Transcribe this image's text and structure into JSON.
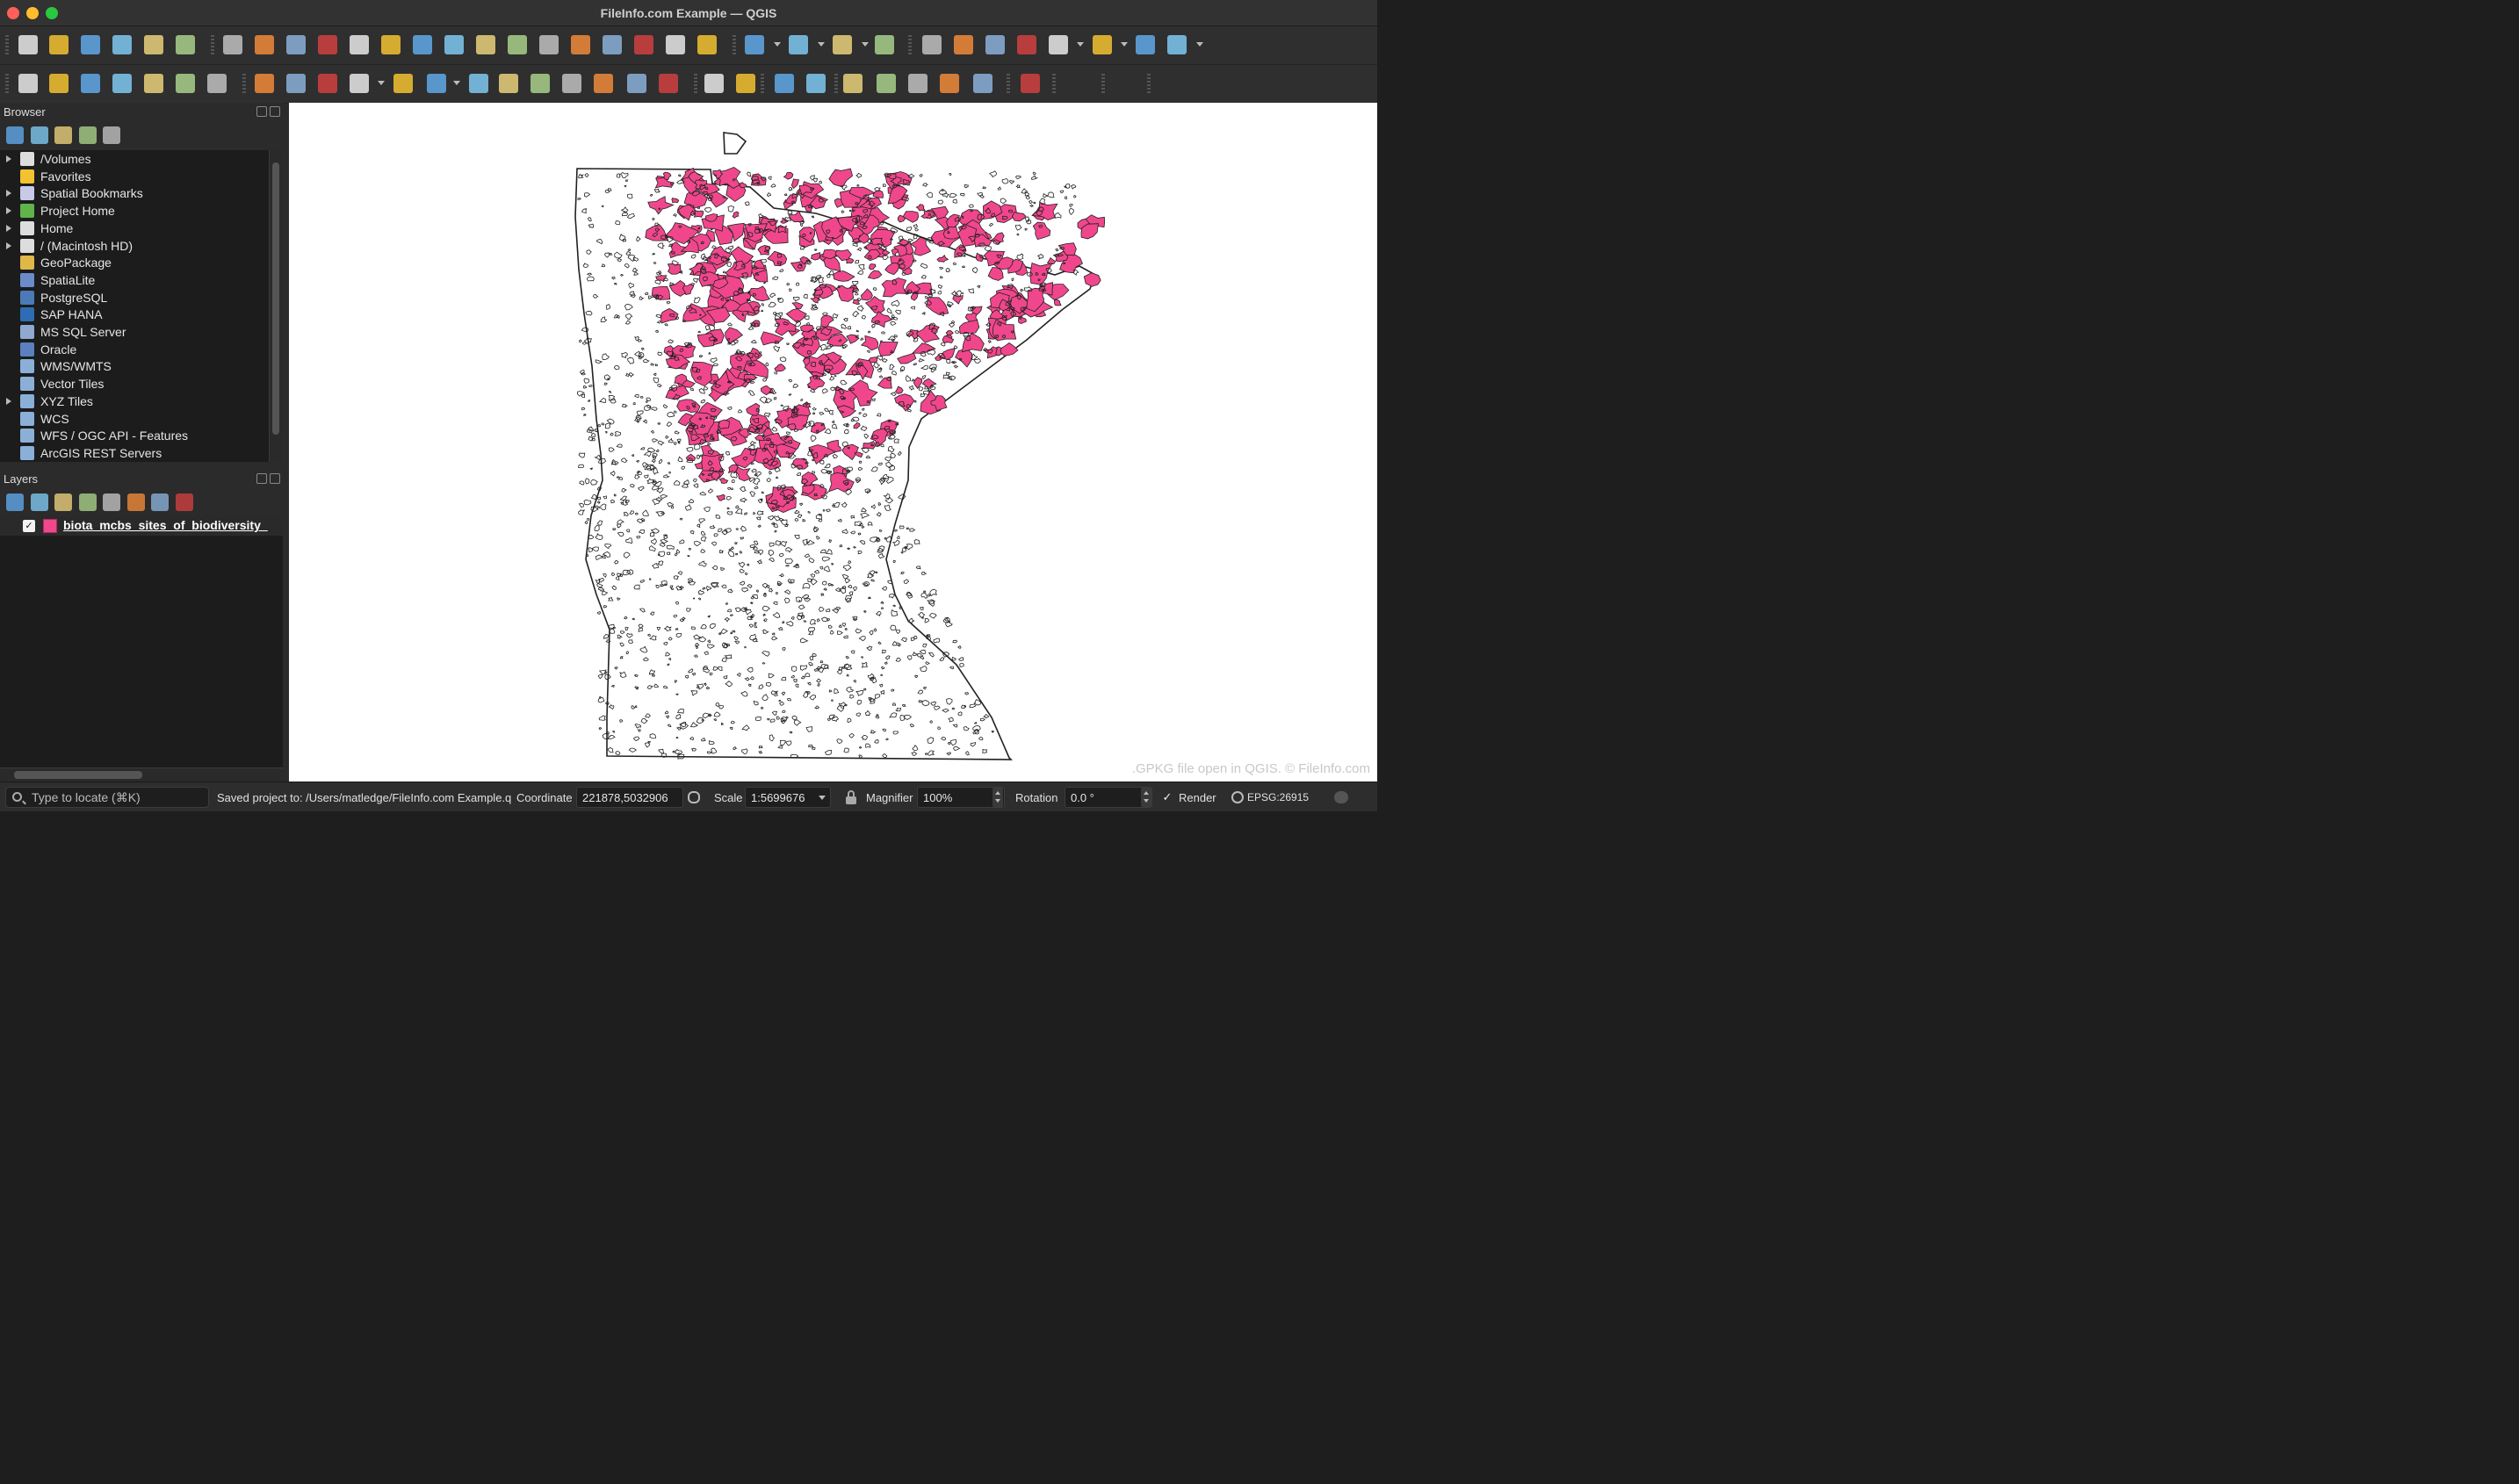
{
  "window": {
    "title": "FileInfo.com Example — QGIS"
  },
  "colors": {
    "layer_fill": "#f0478c",
    "layer_stroke": "#222222",
    "map_background": "#ffffff"
  },
  "toolbar1": {
    "icons": [
      "new-project-icon",
      "open-project-icon",
      "save-project-icon",
      "new-print-layout-icon",
      "style-manager-icon",
      "layout-manager-icon",
      "pan-map-icon",
      "pan-to-selection-icon",
      "zoom-in-icon",
      "zoom-out-icon",
      "zoom-full-icon",
      "zoom-to-selection-icon",
      "zoom-to-layer-icon",
      "zoom-native-icon",
      "zoom-last-icon",
      "zoom-next-icon",
      "new-map-view-icon",
      "new-3d-map-view-icon",
      "new-spatial-bookmark-icon",
      "show-bookmarks-icon",
      "temporal-controller-icon",
      "refresh-icon",
      "select-features-icon",
      "select-by-value-icon",
      "deselect-icon",
      "select-by-location-icon",
      "identify-features-icon",
      "attribute-table-icon",
      "toolbox-icon",
      "statistics-icon",
      "open-table-icon",
      "measure-icon",
      "map-tips-icon",
      "actions-icon"
    ]
  },
  "toolbar2": {
    "icons": [
      "data-source-manager-icon",
      "new-geopackage-layer-icon",
      "new-temporary-layer-icon",
      "digitize-icon",
      "create-layer-icon",
      "wms-layer-icon",
      "virtual-layer-icon",
      "current-edits-icon",
      "toggle-editing-icon",
      "save-edits-icon",
      "digitize-line-icon",
      "vertex-tool-icon",
      "modify-attributes-icon",
      "delete-selected-icon",
      "cut-features-icon",
      "copy-features-icon",
      "paste-features-icon",
      "undo-icon",
      "redo-icon",
      "label-toolbar-icon",
      "diagram-toolbar-icon",
      "pin-labels-icon",
      "highlight-labels-icon",
      "show-hide-labels-icon",
      "move-label-icon",
      "rotate-label-icon",
      "change-label-icon",
      "plugin-icon",
      "python-console-icon",
      "help-icon"
    ]
  },
  "browser": {
    "title": "Browser",
    "tools": [
      "add-selected-icon",
      "refresh-icon",
      "filter-icon",
      "collapse-all-icon",
      "properties-icon"
    ],
    "items": [
      {
        "label": "/Volumes",
        "icon": "folder-icon",
        "expandable": true,
        "color": "#dddddd"
      },
      {
        "label": "Favorites",
        "icon": "star-icon",
        "expandable": false,
        "color": "#f2c230"
      },
      {
        "label": "Spatial Bookmarks",
        "icon": "bookmark-icon",
        "expandable": true,
        "color": "#c9c9e8"
      },
      {
        "label": "Project Home",
        "icon": "project-home-icon",
        "expandable": true,
        "color": "#5fb34a"
      },
      {
        "label": "Home",
        "icon": "home-icon",
        "expandable": true,
        "color": "#dddddd"
      },
      {
        "label": "/ (Macintosh HD)",
        "icon": "folder-icon",
        "expandable": true,
        "color": "#dddddd"
      },
      {
        "label": "GeoPackage",
        "icon": "geopackage-icon",
        "expandable": false,
        "color": "#e0b84a"
      },
      {
        "label": "SpatiaLite",
        "icon": "spatialite-icon",
        "expandable": false,
        "color": "#6b8cc9"
      },
      {
        "label": "PostgreSQL",
        "icon": "postgresql-icon",
        "expandable": false,
        "color": "#4b7bb6"
      },
      {
        "label": "SAP HANA",
        "icon": "sap-hana-icon",
        "expandable": false,
        "color": "#2e6cb5"
      },
      {
        "label": "MS SQL Server",
        "icon": "mssql-icon",
        "expandable": false,
        "color": "#8fa9cf"
      },
      {
        "label": "Oracle",
        "icon": "oracle-icon",
        "expandable": false,
        "color": "#5b7fbf"
      },
      {
        "label": "WMS/WMTS",
        "icon": "wms-icon",
        "expandable": false,
        "color": "#8ab0d8"
      },
      {
        "label": "Vector Tiles",
        "icon": "vector-tiles-icon",
        "expandable": false,
        "color": "#8ab0d8"
      },
      {
        "label": "XYZ Tiles",
        "icon": "xyz-tiles-icon",
        "expandable": true,
        "color": "#8ab0d8"
      },
      {
        "label": "WCS",
        "icon": "wcs-icon",
        "expandable": false,
        "color": "#8ab0d8"
      },
      {
        "label": "WFS / OGC API - Features",
        "icon": "wfs-icon",
        "expandable": false,
        "color": "#8ab0d8"
      },
      {
        "label": "ArcGIS REST Servers",
        "icon": "arcgis-icon",
        "expandable": false,
        "color": "#8ab0d8"
      }
    ]
  },
  "layers": {
    "title": "Layers",
    "tools": [
      "open-styling-icon",
      "add-group-icon",
      "manage-visibility-icon",
      "filter-legend-icon",
      "filter-by-expression-icon",
      "expand-all-icon",
      "collapse-all-icon",
      "remove-layer-icon"
    ],
    "items": [
      {
        "name": "biota_mcbs_sites_of_biodiversity_",
        "checked": true,
        "check_glyph": "✓"
      }
    ]
  },
  "map": {
    "watermark": ".GPKG file open in QGIS. © FileInfo.com"
  },
  "statusbar": {
    "locator_placeholder": "Type to locate (⌘K)",
    "message": "Saved project to: /Users/matledge/FileInfo.com Example.q",
    "coordinate_label": "Coordinate",
    "coordinate_value": "221878,5032906",
    "scale_label": "Scale",
    "scale_value": "1:5699676",
    "magnifier_label": "Magnifier",
    "magnifier_value": "100%",
    "rotation_label": "Rotation",
    "rotation_value": "0.0 °",
    "render_label": "Render",
    "render_checked": true,
    "render_check_glyph": "✓",
    "crs": "EPSG:26915"
  }
}
